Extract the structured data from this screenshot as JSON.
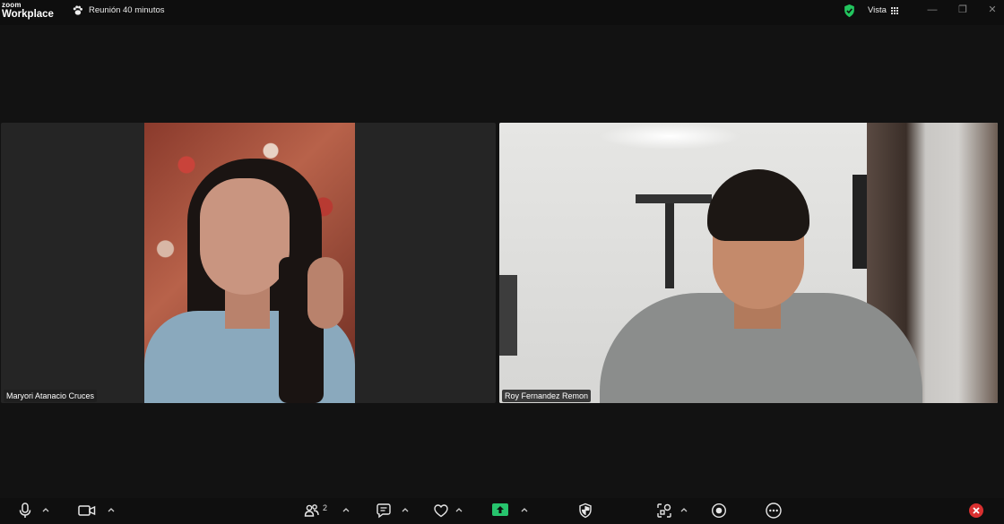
{
  "app": {
    "brand_top": "zoom",
    "brand_bottom": "Workplace",
    "meeting_timer_text": "Reunión 40 minutos"
  },
  "header": {
    "view_label": "Vista",
    "security_color": "#22c55e"
  },
  "participants": [
    {
      "name": "Maryori Atanacio Cruces"
    },
    {
      "name": "Roy Fernandez Remon"
    }
  ],
  "toolbar": {
    "participants_count": "2",
    "share_color": "#27c46d",
    "leave_color": "#d93030",
    "icons": [
      "microphone-icon",
      "video-camera-icon",
      "participants-icon",
      "chat-icon",
      "reactions-icon",
      "share-screen-icon",
      "security-icon",
      "apps-icon",
      "record-icon",
      "more-icon",
      "leave-icon"
    ]
  }
}
